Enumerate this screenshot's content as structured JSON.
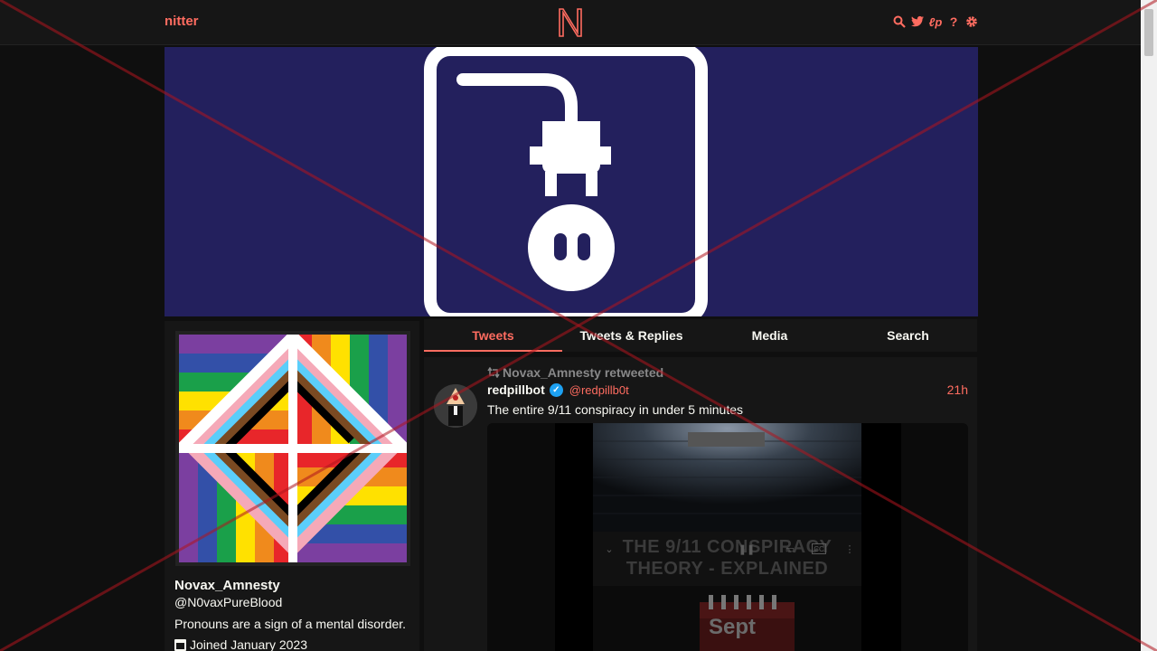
{
  "nav": {
    "brand": "nitter",
    "logo_letter": "N",
    "icons": [
      "search-icon",
      "twitter-bird-icon",
      "rss-icon",
      "help-icon",
      "settings-icon"
    ],
    "rss_glyph": "ℓp",
    "help_glyph": "?"
  },
  "profile": {
    "fullname": "Novax_Amnesty",
    "username": "@N0vaxPureBlood",
    "bio": "Pronouns are a sign of a mental disorder.",
    "joined": "Joined January 2023"
  },
  "tabs": [
    {
      "label": "Tweets",
      "active": true
    },
    {
      "label": "Tweets & Replies",
      "active": false
    },
    {
      "label": "Media",
      "active": false
    },
    {
      "label": "Search",
      "active": false
    }
  ],
  "tweet": {
    "retweet_by": "Novax_Amnesty retweeted",
    "fullname": "redpillbot",
    "verified_glyph": "✓",
    "username": "@redpillb0t",
    "date": "21h",
    "text": "The entire 9/11 conspiracy in under 5 minutes",
    "video_title_line1": "THE 9/11 CONSPIRACY",
    "video_title_line2": "THEORY - EXPLAINED",
    "video_calendar_text": "Sept"
  },
  "colors": {
    "accent": "#ff6c60",
    "background": "#0f0f0f",
    "panel": "#161616",
    "banner": "#23205d",
    "verified": "#1da1f2"
  }
}
